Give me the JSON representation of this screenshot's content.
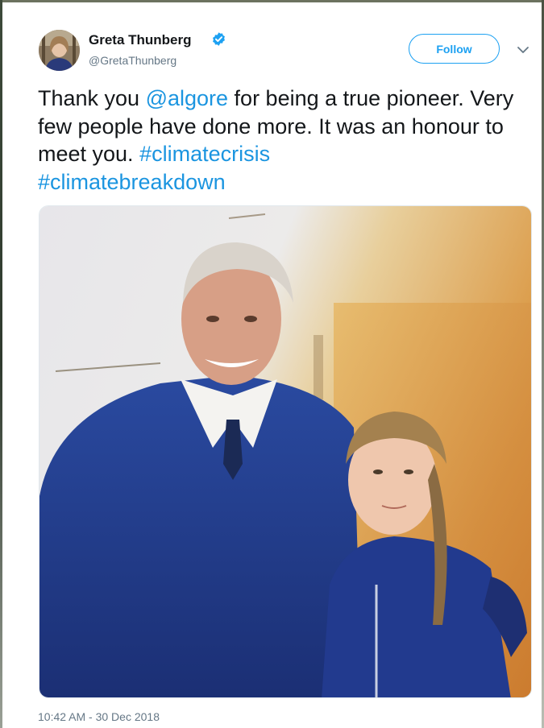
{
  "tweet": {
    "author_name": "Greta Thunberg",
    "author_handle": "@GretaThunberg",
    "verified": true,
    "follow_label": "Follow",
    "text_parts": {
      "p1": "Thank you ",
      "mention": "@algore",
      "p2": " for being a true pioneer. Very few people have done more. It was an honour to meet you. ",
      "hashtag1": "#climatecrisis",
      "hashtag2": "#climatebreakdown"
    },
    "timestamp": "10:42 AM - 30 Dec 2018"
  },
  "colors": {
    "link": "#1b95e0",
    "follow_border": "#1da1f2",
    "verified_badge": "#1da1f2",
    "text_primary": "#14171a",
    "text_secondary": "#657786"
  },
  "icons": {
    "verified": "verified-badge-icon",
    "caret": "chevron-down-icon"
  }
}
